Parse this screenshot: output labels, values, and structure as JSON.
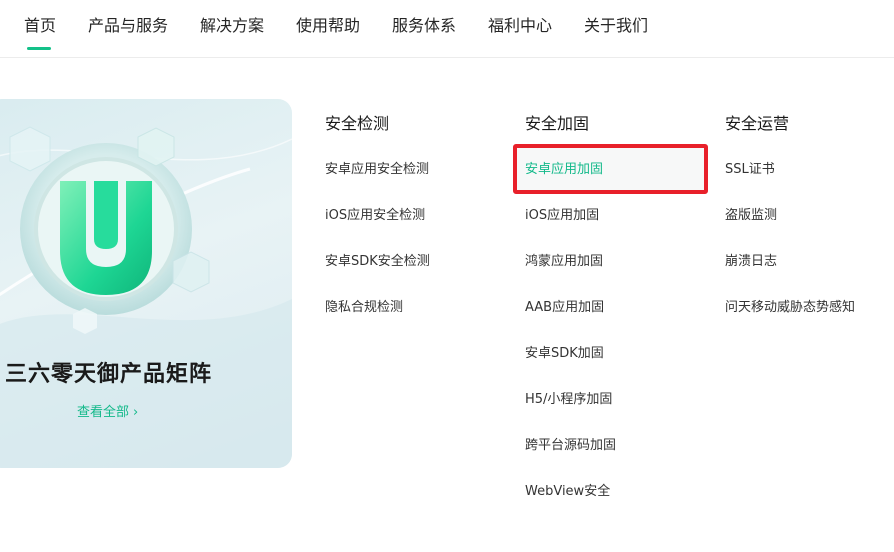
{
  "nav": {
    "items": [
      "首页",
      "产品与服务",
      "解决方案",
      "使用帮助",
      "服务体系",
      "福利中心",
      "关于我们"
    ],
    "active_index": 0
  },
  "banner": {
    "title": "三六零天御产品矩阵",
    "link": "查看全部",
    "link_icon": "chevron-right-icon"
  },
  "columns": [
    {
      "title": "安全检测",
      "items": [
        "安卓应用安全检测",
        "iOS应用安全检测",
        "安卓SDK安全检测",
        "隐私合规检测"
      ]
    },
    {
      "title": "安全加固",
      "items": [
        "安卓应用加固",
        "iOS应用加固",
        "鸿蒙应用加固",
        "AAB应用加固",
        "安卓SDK加固",
        "H5/小程序加固",
        "跨平台源码加固",
        "WebView安全"
      ],
      "highlighted_index": 0
    },
    {
      "title": "安全运营",
      "items": [
        "SSL证书",
        "盗版监测",
        "崩溃日志",
        "问天移动威胁态势感知"
      ]
    }
  ],
  "colors": {
    "accent": "#13c189",
    "highlight_border": "#e8202a"
  }
}
